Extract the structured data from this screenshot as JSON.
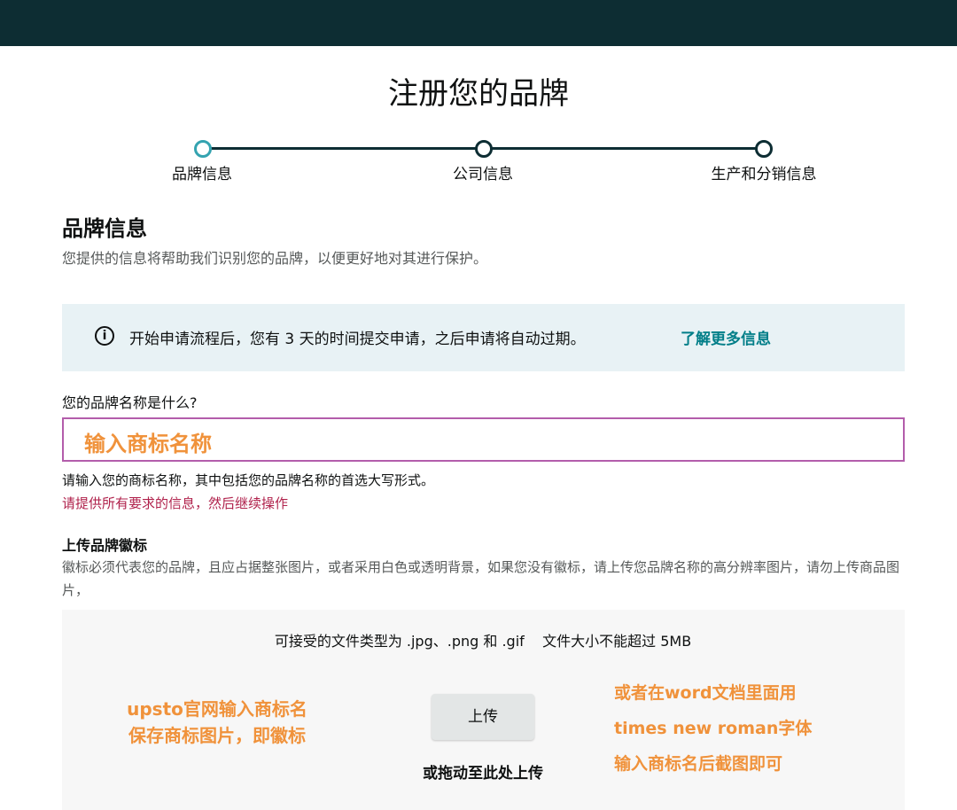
{
  "header": {
    "title": "注册您的品牌"
  },
  "steps": [
    {
      "label": "品牌信息",
      "active": true
    },
    {
      "label": "公司信息",
      "active": false
    },
    {
      "label": "生产和分销信息",
      "active": false
    }
  ],
  "brand_info": {
    "title": "品牌信息",
    "description": "您提供的信息将帮助我们识别您的品牌，以便更好地对其进行保护。"
  },
  "notice": {
    "icon": "info-icon",
    "text": "开始申请流程后，您有 3 天的时间提交申请，之后申请将自动过期。",
    "link": "了解更多信息"
  },
  "brand_name": {
    "question": "您的品牌名称是什么?",
    "overlay_text": "输入商标名称",
    "hint": "请输入您的商标名称，其中包括您的品牌名称的首选大写形式。",
    "error": "请提供所有要求的信息，然后继续操作"
  },
  "logo_upload": {
    "title": "上传品牌徽标",
    "description": "徽标必须代表您的品牌，且应占据整张图片，或者采用白色或透明背景，如果您没有徽标，请上传您品牌名称的高分辨率图片，请勿上传商品图片，",
    "file_types": "可接受的文件类型为 .jpg、.png 和 .gif    文件大小不能超过 5MB",
    "button_label": "上传",
    "drag_text": "或拖动至此处上传"
  },
  "annotations": {
    "left": [
      "upsto官网输入商标名",
      "保存商标图片，即徽标"
    ],
    "right": [
      "或者在word文档里面用",
      "times new roman字体",
      "输入商标名后截图即可"
    ]
  },
  "colors": {
    "topbar": "#0d2d33",
    "accent_step": "#34a3b0",
    "link": "#017e88",
    "error": "#b0224c",
    "input_border": "#b35dab",
    "annotation": "#f0923b"
  }
}
